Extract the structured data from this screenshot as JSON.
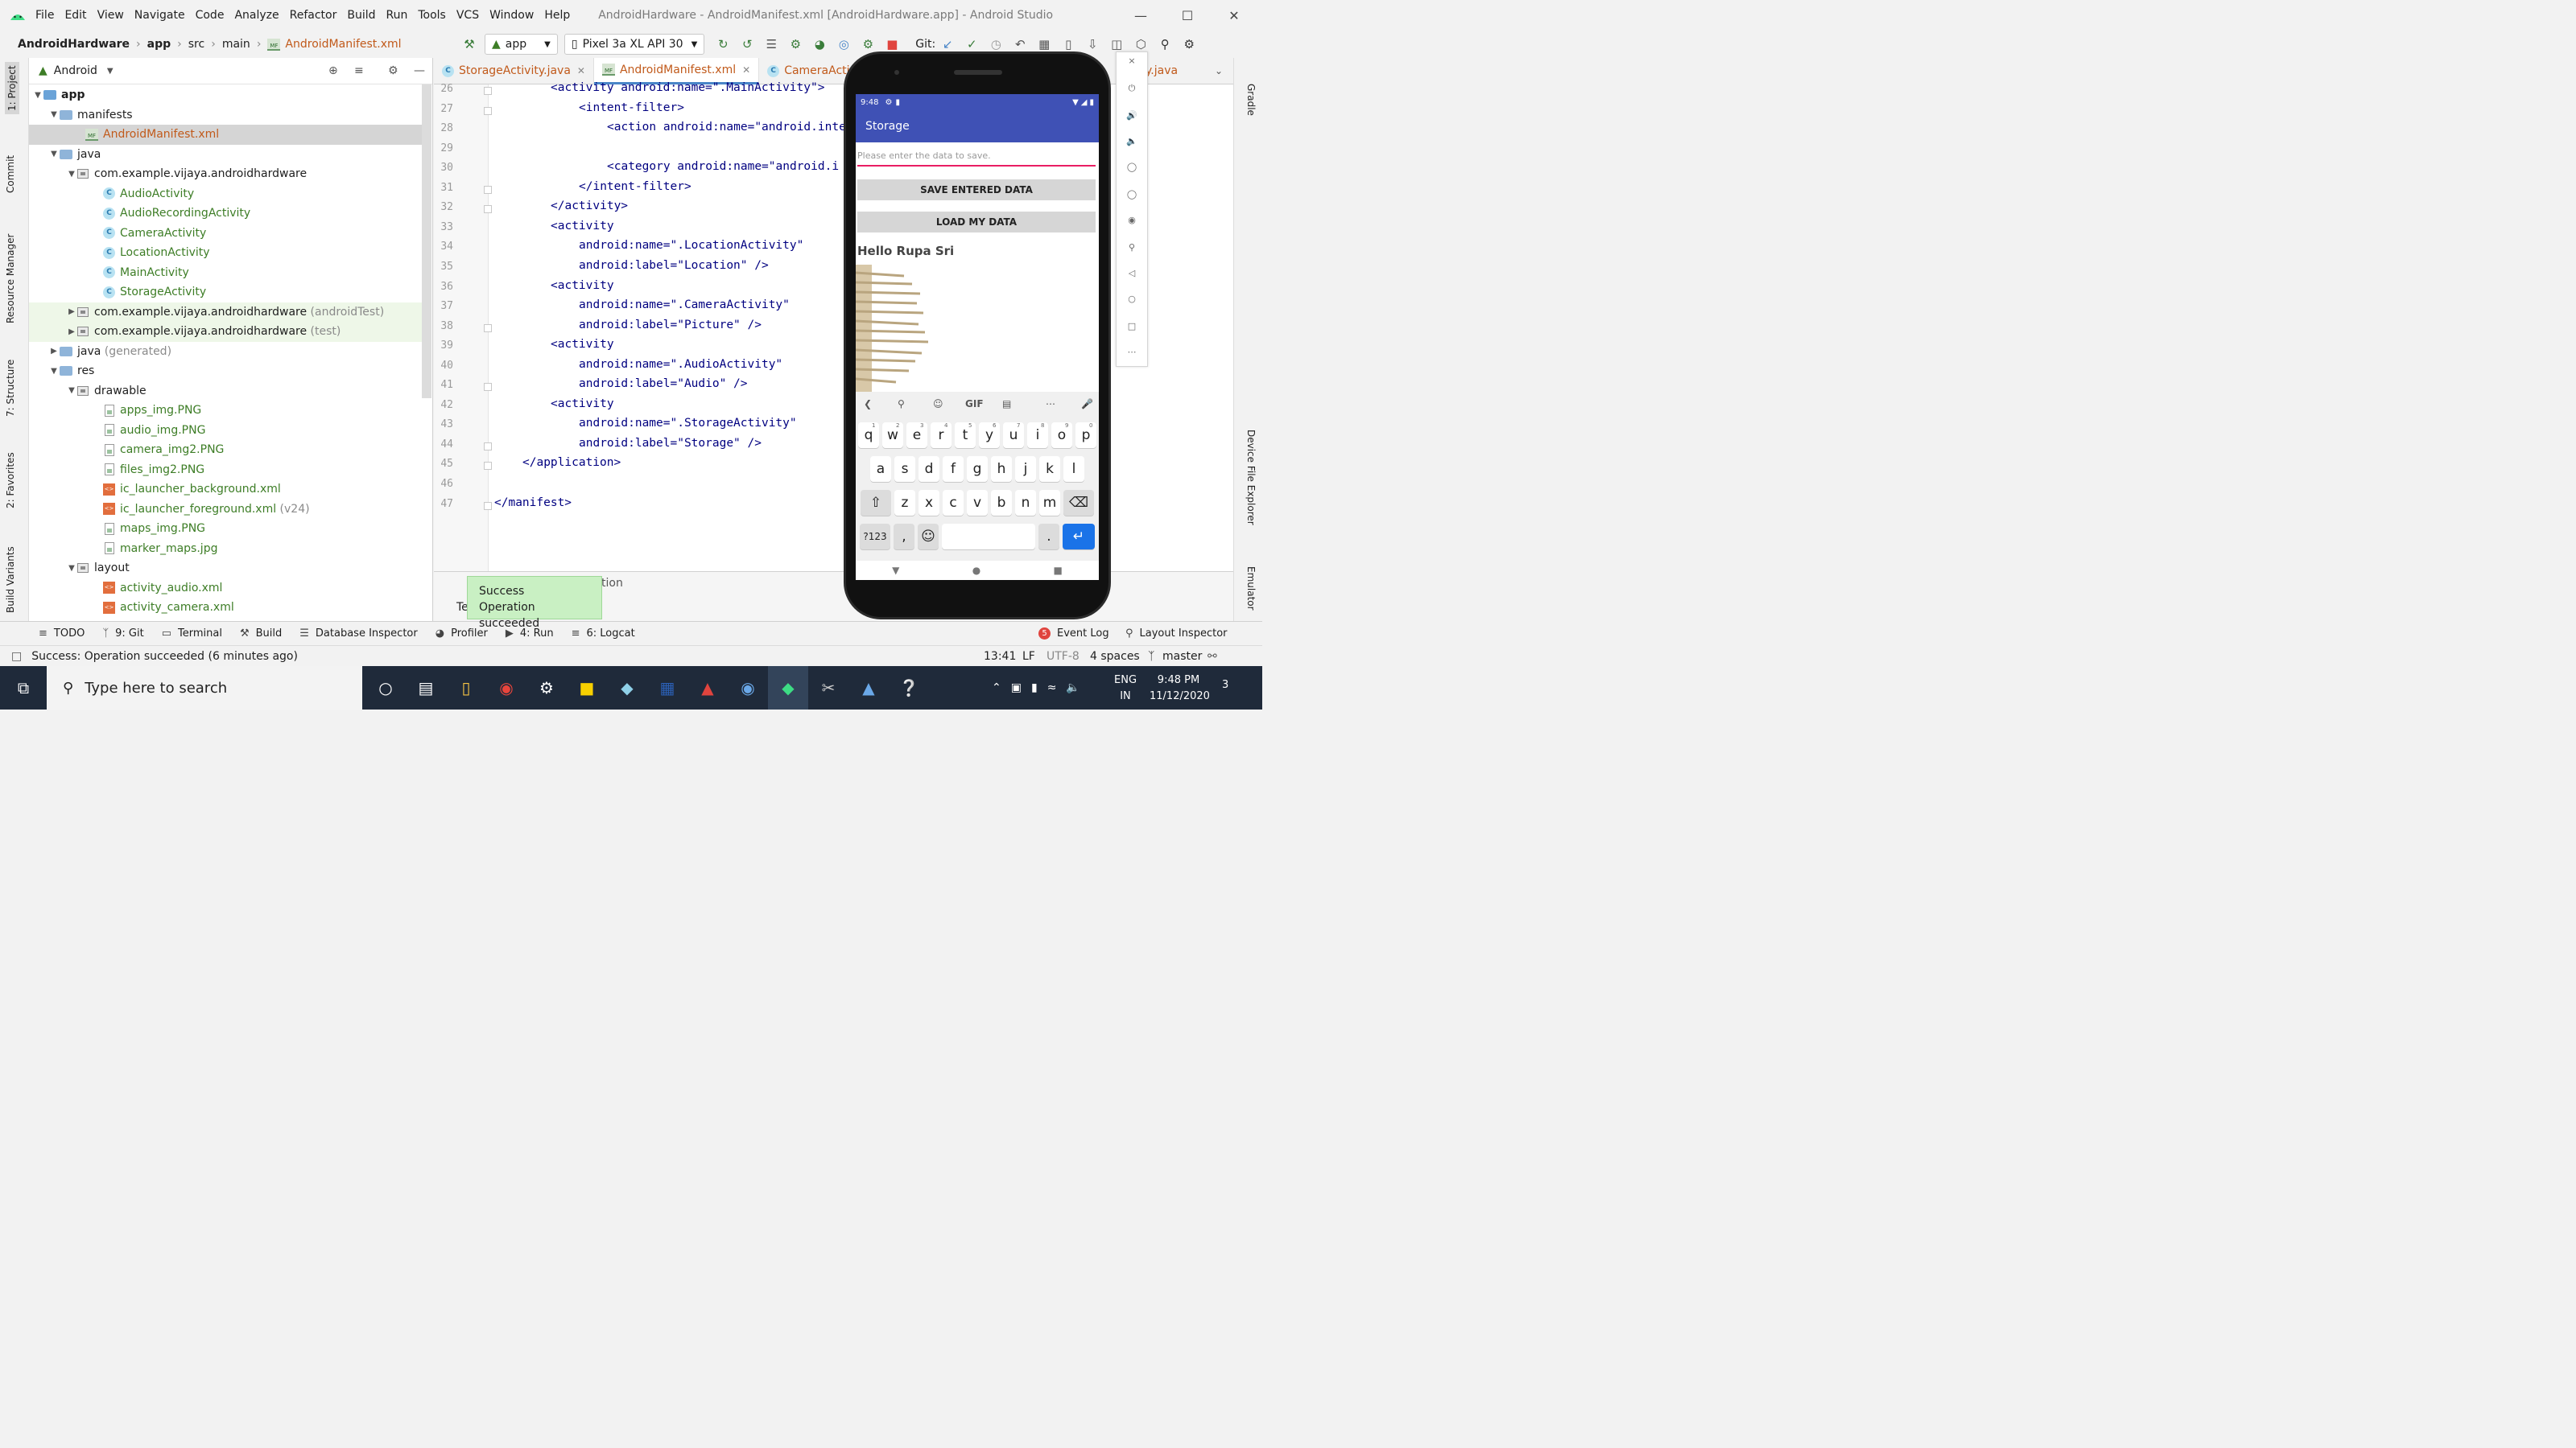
{
  "window": {
    "title": "AndroidHardware - AndroidManifest.xml [AndroidHardware.app] - Android Studio",
    "menu": [
      "File",
      "Edit",
      "View",
      "Navigate",
      "Code",
      "Analyze",
      "Refactor",
      "Build",
      "Run",
      "Tools",
      "VCS",
      "Window",
      "Help"
    ]
  },
  "navbar": {
    "crumbs": [
      "AndroidHardware",
      "app",
      "src",
      "main",
      "AndroidManifest.xml"
    ],
    "run_config": "app",
    "device": "Pixel 3a XL API 30",
    "git_label": "Git:"
  },
  "left_tabs": [
    "1: Project",
    "Commit",
    "Resource Manager",
    "7: Structure",
    "2: Favorites",
    "Build Variants"
  ],
  "right_tabs": [
    "Gradle",
    "Device File Explorer",
    "Emulator"
  ],
  "project": {
    "view": "Android",
    "tree": [
      {
        "label": "app",
        "extra": ""
      },
      {
        "label": "manifests",
        "extra": ""
      },
      {
        "label": "AndroidManifest.xml",
        "extra": ""
      },
      {
        "label": "java",
        "extra": ""
      },
      {
        "label": "com.example.vijaya.androidhardware",
        "extra": ""
      },
      {
        "label": "AudioActivity",
        "extra": ""
      },
      {
        "label": "AudioRecordingActivity",
        "extra": ""
      },
      {
        "label": "CameraActivity",
        "extra": ""
      },
      {
        "label": "LocationActivity",
        "extra": ""
      },
      {
        "label": "MainActivity",
        "extra": ""
      },
      {
        "label": "StorageActivity",
        "extra": ""
      },
      {
        "label": "com.example.vijaya.androidhardware",
        "extra": "(androidTest)"
      },
      {
        "label": "com.example.vijaya.androidhardware",
        "extra": "(test)"
      },
      {
        "label": "java",
        "extra": "(generated)"
      },
      {
        "label": "res",
        "extra": ""
      },
      {
        "label": "drawable",
        "extra": ""
      },
      {
        "label": "apps_img.PNG",
        "extra": ""
      },
      {
        "label": "audio_img.PNG",
        "extra": ""
      },
      {
        "label": "camera_img2.PNG",
        "extra": ""
      },
      {
        "label": "files_img2.PNG",
        "extra": ""
      },
      {
        "label": "ic_launcher_background.xml",
        "extra": ""
      },
      {
        "label": "ic_launcher_foreground.xml",
        "extra": "(v24)"
      },
      {
        "label": "maps_img.PNG",
        "extra": ""
      },
      {
        "label": "marker_maps.jpg",
        "extra": ""
      },
      {
        "label": "layout",
        "extra": ""
      },
      {
        "label": "activity_audio.xml",
        "extra": ""
      },
      {
        "label": "activity_camera.xml",
        "extra": ""
      }
    ]
  },
  "editor": {
    "tabs": [
      "StorageActivity.java",
      "AndroidManifest.xml",
      "CameraActivity",
      "y.java"
    ],
    "lines": [
      {
        "n": "26",
        "text": "<activity android:name=\".MainActivity\">"
      },
      {
        "n": "27",
        "text": "<intent-filter>"
      },
      {
        "n": "28",
        "text": "<action android:name=\"android.inte"
      },
      {
        "n": "29",
        "text": ""
      },
      {
        "n": "30",
        "text": "<category android:name=\"android.i"
      },
      {
        "n": "31",
        "text": "</intent-filter>"
      },
      {
        "n": "32",
        "text": "</activity>"
      },
      {
        "n": "33",
        "text": "<activity"
      },
      {
        "n": "34",
        "text": "android:name=\".LocationActivity\""
      },
      {
        "n": "35",
        "text": "android:label=\"Location\" />"
      },
      {
        "n": "36",
        "text": "<activity"
      },
      {
        "n": "37",
        "text": "android:name=\".CameraActivity\""
      },
      {
        "n": "38",
        "text": "android:label=\"Picture\" />"
      },
      {
        "n": "39",
        "text": "<activity"
      },
      {
        "n": "40",
        "text": "android:name=\".AudioActivity\""
      },
      {
        "n": "41",
        "text": "android:label=\"Audio\" />"
      },
      {
        "n": "42",
        "text": "<activity"
      },
      {
        "n": "43",
        "text": "android:name=\".StorageActivity\""
      },
      {
        "n": "44",
        "text": "android:label=\"Storage\" />"
      },
      {
        "n": "45",
        "text": "</application>"
      },
      {
        "n": "46",
        "text": ""
      },
      {
        "n": "47",
        "text": "</manifest>"
      }
    ]
  },
  "runpanel": {
    "partial_label": "tion",
    "tab_partial": "Te"
  },
  "toast": {
    "title": "Success",
    "message": "Operation succeeded"
  },
  "bottom_tools": [
    "TODO",
    "9: Git",
    "Terminal",
    "Build",
    "Database Inspector",
    "Profiler",
    "4: Run",
    "6: Logcat",
    "Event Log",
    "Layout Inspector"
  ],
  "event_log_count": "5",
  "status": {
    "message": "Success: Operation succeeded (6 minutes ago)",
    "position": "13:41",
    "line_sep": "LF",
    "encoding": "UTF-8",
    "indent": "4 spaces",
    "branch": "master"
  },
  "phone": {
    "time": "9:48",
    "app_title": "Storage",
    "input_placeholder": "Please enter the data to save.",
    "save_button": "SAVE ENTERED DATA",
    "load_button": "LOAD MY DATA",
    "loaded_text": "Hello Rupa Sri",
    "kb_row1": [
      "q",
      "w",
      "e",
      "r",
      "t",
      "y",
      "u",
      "i",
      "o",
      "p"
    ],
    "kb_digits": [
      "1",
      "2",
      "3",
      "4",
      "5",
      "6",
      "7",
      "8",
      "9",
      "0"
    ],
    "kb_row2": [
      "a",
      "s",
      "d",
      "f",
      "g",
      "h",
      "j",
      "k",
      "l"
    ],
    "kb_row3": [
      "z",
      "x",
      "c",
      "v",
      "b",
      "n",
      "m"
    ],
    "kb_sym": "?123",
    "kb_comma": ",",
    "kb_period": ".",
    "kb_gif": "GIF"
  },
  "taskbar": {
    "search_placeholder": "Type here to search",
    "lang": "ENG",
    "region": "IN",
    "time": "9:48 PM",
    "date": "11/12/2020",
    "notifications": "3"
  },
  "colors": {
    "accent": "#3f51b5",
    "error_underline": "#e91e63",
    "toast": "#c9f0c3",
    "selection": "#d5d5d5"
  }
}
